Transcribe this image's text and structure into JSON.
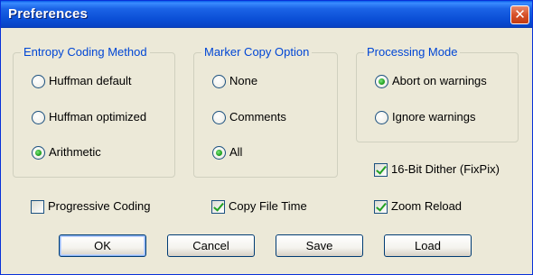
{
  "window": {
    "title": "Preferences",
    "close_symbol": "✕"
  },
  "groups": {
    "entropy": {
      "legend": "Entropy Coding Method",
      "options": [
        {
          "label": "Huffman default",
          "selected": false
        },
        {
          "label": "Huffman optimized",
          "selected": false
        },
        {
          "label": "Arithmetic",
          "selected": true
        }
      ]
    },
    "marker": {
      "legend": "Marker Copy Option",
      "options": [
        {
          "label": "None",
          "selected": false
        },
        {
          "label": "Comments",
          "selected": false
        },
        {
          "label": "All",
          "selected": true
        }
      ]
    },
    "processing": {
      "legend": "Processing Mode",
      "options": [
        {
          "label": "Abort on warnings",
          "selected": true
        },
        {
          "label": "Ignore warnings",
          "selected": false
        }
      ]
    }
  },
  "checkboxes": {
    "dither": {
      "label": "16-Bit Dither (FixPix)",
      "checked": true
    },
    "progressive": {
      "label": "Progressive Coding",
      "checked": false
    },
    "copy_file_time": {
      "label": "Copy File Time",
      "checked": true
    },
    "zoom_reload": {
      "label": "Zoom Reload",
      "checked": true
    }
  },
  "buttons": {
    "ok": "OK",
    "cancel": "Cancel",
    "save": "Save",
    "load": "Load"
  },
  "colors": {
    "title_bar": "#0b4fd6",
    "legend": "#0046d5",
    "face": "#ece9d8",
    "check_green": "#21a121",
    "close_red": "#d7522a"
  }
}
